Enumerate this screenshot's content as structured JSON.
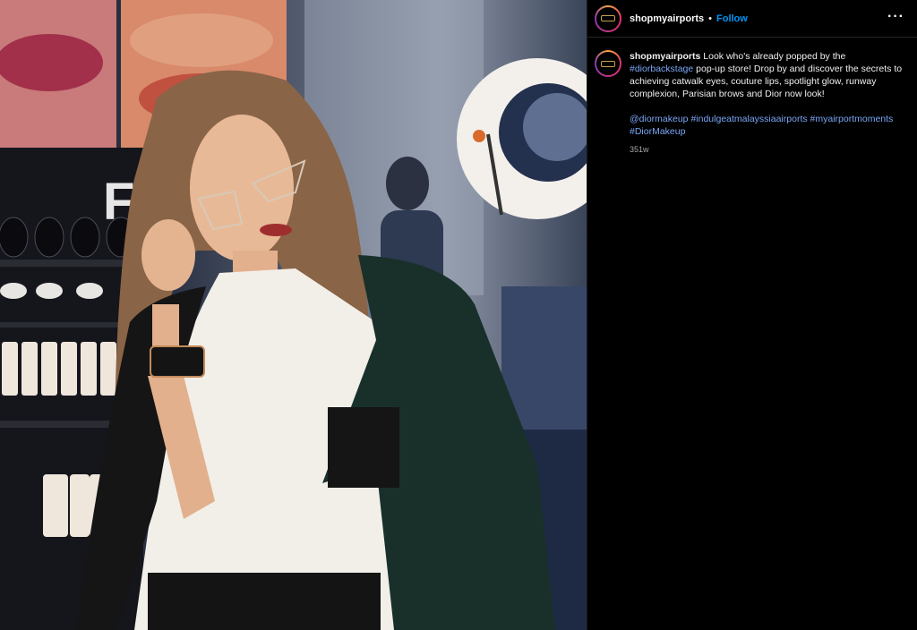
{
  "post": {
    "username": "shopmyairports",
    "separator": "•",
    "follow_label": "Follow",
    "more_label": "···",
    "caption": {
      "username": "shopmyairports",
      "text_1": "Look who's already popped by the",
      "hashtag_1": "#diorbackstage",
      "text_2": "pop-up store! Drop by and discover the secrets to achieving catwalk eyes, couture lips, spotlight glow, runway complexion, Parisian brows and Dior now look!",
      "tags": [
        "@diormakeup",
        "#indulgeatmalayssiaairports",
        "#myairportmoments",
        "#DiorMakeup"
      ]
    },
    "timestamp": "351w"
  },
  "colors": {
    "link": "#0095f6",
    "hashtag": "#7aa6f5",
    "background": "#000000"
  }
}
